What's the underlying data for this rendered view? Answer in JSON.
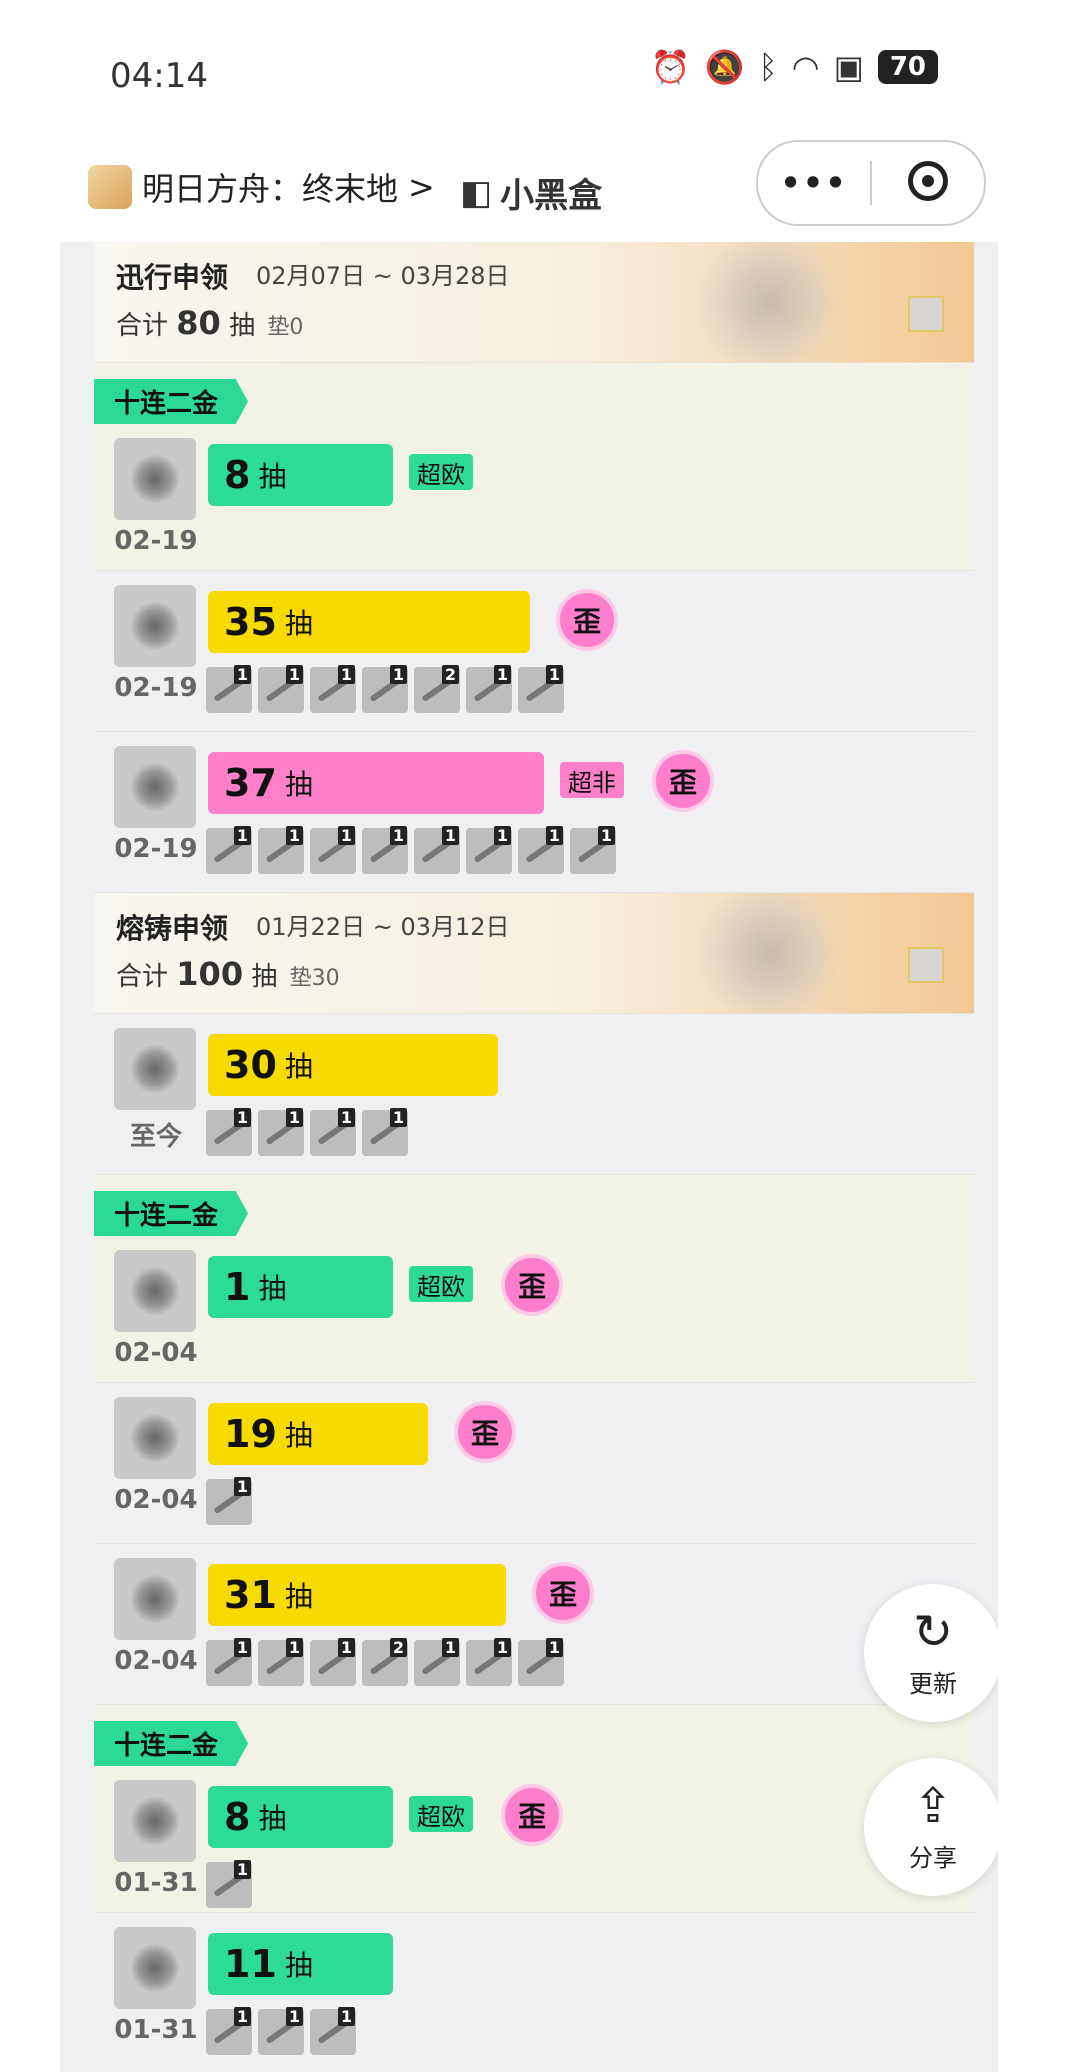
{
  "status": {
    "time": "04:14",
    "icons": [
      "alarm-icon",
      "mute-icon",
      "bluetooth-icon",
      "wifi-icon",
      "sim-icon"
    ],
    "battery": "70"
  },
  "nav": {
    "title": "明日方舟：终末地",
    "chevron": ">",
    "brand": "小黑盒",
    "more": "•••"
  },
  "pools": [
    {
      "name": "迅行申领",
      "range": "02月07日 ~ 03月28日",
      "sum_prefix": "合计",
      "sum": "80",
      "sum_unit": "抽",
      "pad": "垫0"
    },
    {
      "name": "熔铸申领",
      "range": "01月22日 ~ 03月12日",
      "sum_prefix": "合计",
      "sum": "100",
      "sum_unit": "抽",
      "pad": "垫30"
    }
  ],
  "tag_label": "十连二金",
  "pull_unit": "抽",
  "wai_label": "歪",
  "records": [
    {
      "count": "8",
      "date": "02-19",
      "badge": "超欧",
      "color": "green"
    },
    {
      "count": "35",
      "date": "02-19",
      "color": "yellow",
      "wai": "歪",
      "items": [
        "1",
        "1",
        "1",
        "1",
        "2",
        "1",
        "1"
      ]
    },
    {
      "count": "37",
      "date": "02-19",
      "badge": "超非",
      "color": "pink",
      "wai": "歪",
      "items": [
        "1",
        "1",
        "1",
        "1",
        "1",
        "1",
        "1",
        "1"
      ]
    },
    {
      "count": "30",
      "date": "至今",
      "color": "yellow",
      "items": [
        "1",
        "1",
        "1",
        "1"
      ]
    },
    {
      "count": "1",
      "date": "02-04",
      "badge": "超欧",
      "color": "green",
      "wai": "歪"
    },
    {
      "count": "19",
      "date": "02-04",
      "color": "yellow",
      "wai": "歪",
      "items": [
        "1"
      ]
    },
    {
      "count": "31",
      "date": "02-04",
      "color": "yellow",
      "wai": "歪",
      "items": [
        "1",
        "1",
        "1",
        "2",
        "1",
        "1",
        "1"
      ]
    },
    {
      "count": "8",
      "date": "01-31",
      "badge": "超欧",
      "color": "green",
      "wai": "歪",
      "items": [
        "1"
      ]
    },
    {
      "count": "11",
      "date": "01-31",
      "color": "green",
      "items": [
        "1",
        "1",
        "1"
      ]
    }
  ],
  "fabs": {
    "refresh": "更新",
    "share": "分享"
  },
  "colors": {
    "green": "#2cdc96",
    "yellow": "#f6da00",
    "pink": "#ff80c8"
  }
}
